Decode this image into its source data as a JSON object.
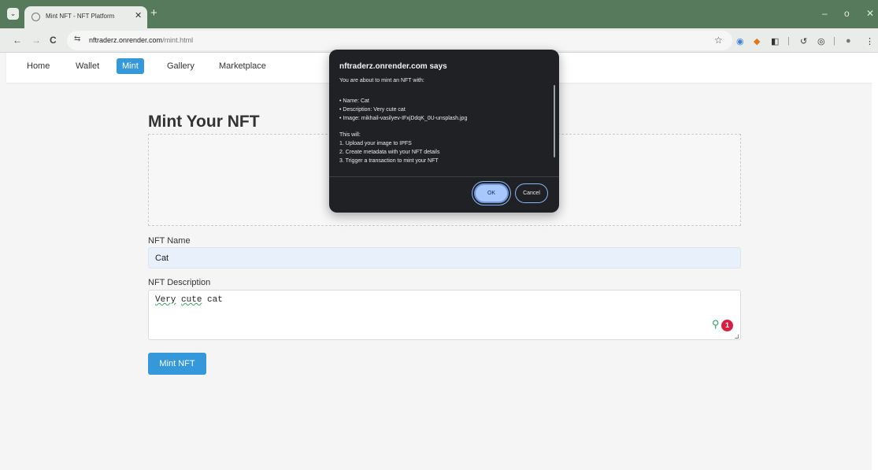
{
  "browser": {
    "menu_icon": "chevron-down-icon",
    "tab_title": "Mint NFT - NFT Platform",
    "tab_close": "✕",
    "new_tab": "+",
    "minimize": "–",
    "restore": "o",
    "close": "✕",
    "back": "←",
    "forward": "→",
    "reload": "C",
    "site_info_icon": "⇆",
    "url_domain": "nftraderz.onrender.com",
    "url_path": "/mint.html",
    "star": "☆"
  },
  "nav": {
    "items": [
      {
        "label": "Home"
      },
      {
        "label": "Wallet"
      },
      {
        "label": "Mint"
      },
      {
        "label": "Gallery"
      },
      {
        "label": "Marketplace"
      }
    ],
    "active": "Mint"
  },
  "main": {
    "title": "Mint Your NFT",
    "name_label": "NFT Name",
    "name_value": "Cat",
    "description_label": "NFT Description",
    "description_word1": "Very",
    "description_word2": "cute",
    "description_word3": " cat",
    "grammar_count": "1",
    "mint_button": "Mint NFT"
  },
  "dialog": {
    "title": "nftraderz.onrender.com says",
    "lines": [
      "You are about to mint an NFT with:",
      "",
      "• Name: Cat",
      "• Description: Very cute cat",
      "• Image: mikhail-vasilyev-IFxjDdqK_0U-unsplash.jpg",
      "",
      "This will:",
      "1. Upload your image to IPFS",
      "2. Create metadata with your NFT details",
      "3. Trigger a transaction to mint your NFT"
    ],
    "ok": "OK",
    "cancel": "Cancel"
  },
  "colors": {
    "accent": "#3498db",
    "titlebar": "#577a5c",
    "dialog_bg": "#202124",
    "ok_button": "#a8c7fa"
  }
}
